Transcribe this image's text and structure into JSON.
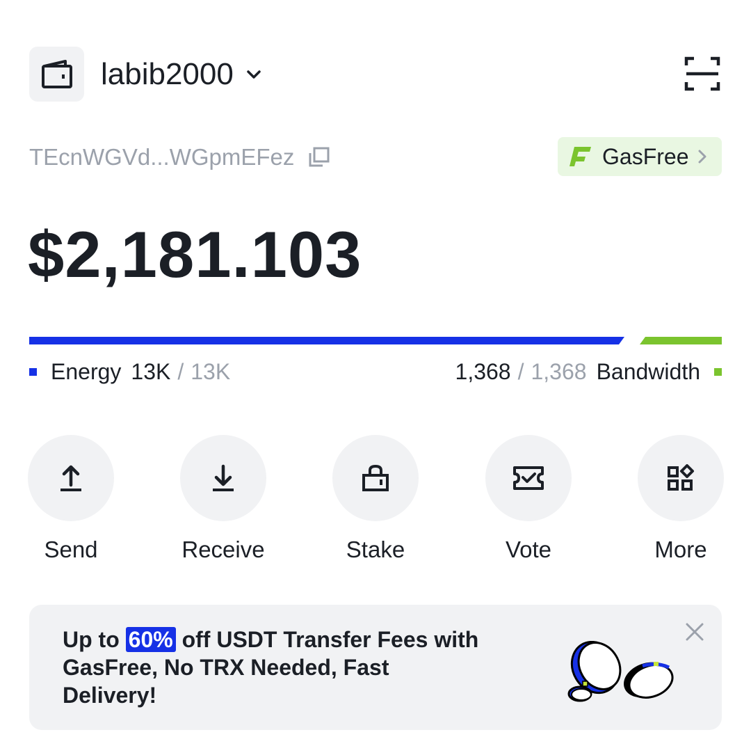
{
  "header": {
    "account_name": "labib2000"
  },
  "address": {
    "short": "TEcnWGVd...WGpmEFez"
  },
  "gasfree": {
    "label": "GasFree"
  },
  "balance": {
    "amount": "$2,181.103"
  },
  "resources": {
    "energy": {
      "label": "Energy",
      "current": "13K",
      "separator": "/",
      "max": "13K",
      "color": "#1631e6"
    },
    "bandwidth": {
      "label": "Bandwidth",
      "current": "1,368",
      "separator": "/",
      "max": "1,368",
      "color": "#7bc42e"
    }
  },
  "actions": [
    {
      "label": "Send",
      "icon": "upload-icon"
    },
    {
      "label": "Receive",
      "icon": "download-icon"
    },
    {
      "label": "Stake",
      "icon": "lock-icon"
    },
    {
      "label": "Vote",
      "icon": "ticket-check-icon"
    },
    {
      "label": "More",
      "icon": "grid-icon"
    }
  ],
  "banner": {
    "text_before": "Up to",
    "highlight": "60%",
    "text_after": "off USDT Transfer Fees with GasFree, No TRX Needed, Fast Delivery!"
  },
  "colors": {
    "accent_blue": "#1631e6",
    "accent_green": "#7bc42e",
    "gasfree_bg": "#e9f7e2",
    "surface_gray": "#f1f2f4",
    "muted_text": "#9ba1ab"
  }
}
